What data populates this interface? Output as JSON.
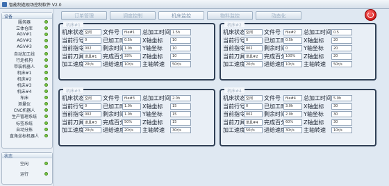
{
  "window": {
    "title": "智能制造现场控制软件 V2.0"
  },
  "tabs": [
    "订单管理",
    "调度控制",
    "机床监控",
    "物料监控",
    "动态化"
  ],
  "sidebar": {
    "devices_header": "设备",
    "devices": [
      "服务器",
      "立体仓库",
      "AGV#1",
      "AGV#2",
      "AGV#3",
      "自动加工线",
      "行走机构",
      "带装机器人",
      "机床#1",
      "机床#2",
      "机床#3",
      "机床#4",
      "车床",
      "测量仪",
      "CNC机器人",
      "生产管理系统",
      "标签系统",
      "自动分拣",
      "直角坐标机器人"
    ],
    "status_header": "状态",
    "status": [
      "空闲",
      "运行"
    ]
  },
  "panels": [
    {
      "title": "机床#1",
      "status": "空闲",
      "file": "file#1",
      "process_time": "1.5h",
      "current_line": "0",
      "processed_time": "0.5h",
      "x_coord": "10",
      "segment": "002",
      "remaining_time": "1.0h",
      "y_coord": "10",
      "tool": "道具#1",
      "percent": "33%",
      "z_coord": "10",
      "speed": "20r/s",
      "feed_speed": "10r/s",
      "spindle_speed": "50r/s"
    },
    {
      "title": "机床#2",
      "status": "空闲",
      "file": "file#2",
      "process_time": "0.5",
      "current_line": "0",
      "processed_time": "0.5h",
      "x_coord": "20",
      "segment": "002",
      "remaining_time": "0",
      "y_coord": "20",
      "tool": "道具#2",
      "percent": "100%",
      "z_coord": "20",
      "speed": "20r/s",
      "feed_speed": "10r/s",
      "spindle_speed": "50r/s"
    },
    {
      "title": "机床#3",
      "status": "空闲",
      "file": "file#3",
      "process_time": "2.0h",
      "current_line": "0",
      "processed_time": "1.0h",
      "x_coord": "15",
      "segment": "002",
      "remaining_time": "1.0h",
      "y_coord": "15",
      "tool": "道具#3",
      "percent": "50%",
      "z_coord": "15",
      "speed": "20r/s",
      "feed_speed": "20r/s",
      "spindle_speed": "30r/s"
    },
    {
      "title": "机床#4",
      "status": "空闲",
      "file": "file#4",
      "process_time": "5.0h",
      "current_line": "0",
      "processed_time": "3.0h",
      "x_coord": "30",
      "segment": "002",
      "remaining_time": "2.0h",
      "y_coord": "30",
      "tool": "道具#4",
      "percent": "60%",
      "z_coord": "30",
      "speed": "50r/s",
      "feed_speed": "30r/s",
      "spindle_speed": "10r/s"
    }
  ],
  "labels": {
    "status": "机床状态",
    "file": "文件号",
    "process_time": "总加工时间",
    "current_line": "当前行号",
    "processed_time": "已加工时间",
    "x_coord": "X轴坐标",
    "segment": "当前指令",
    "remaining_time": "剩余时间",
    "y_coord": "Y轴坐标",
    "tool": "当前刀具",
    "percent": "完成百分比",
    "z_coord": "Z轴坐标",
    "speed": "加工速度",
    "feed_speed": "进给速度",
    "spindle_speed": "主轴转速"
  }
}
